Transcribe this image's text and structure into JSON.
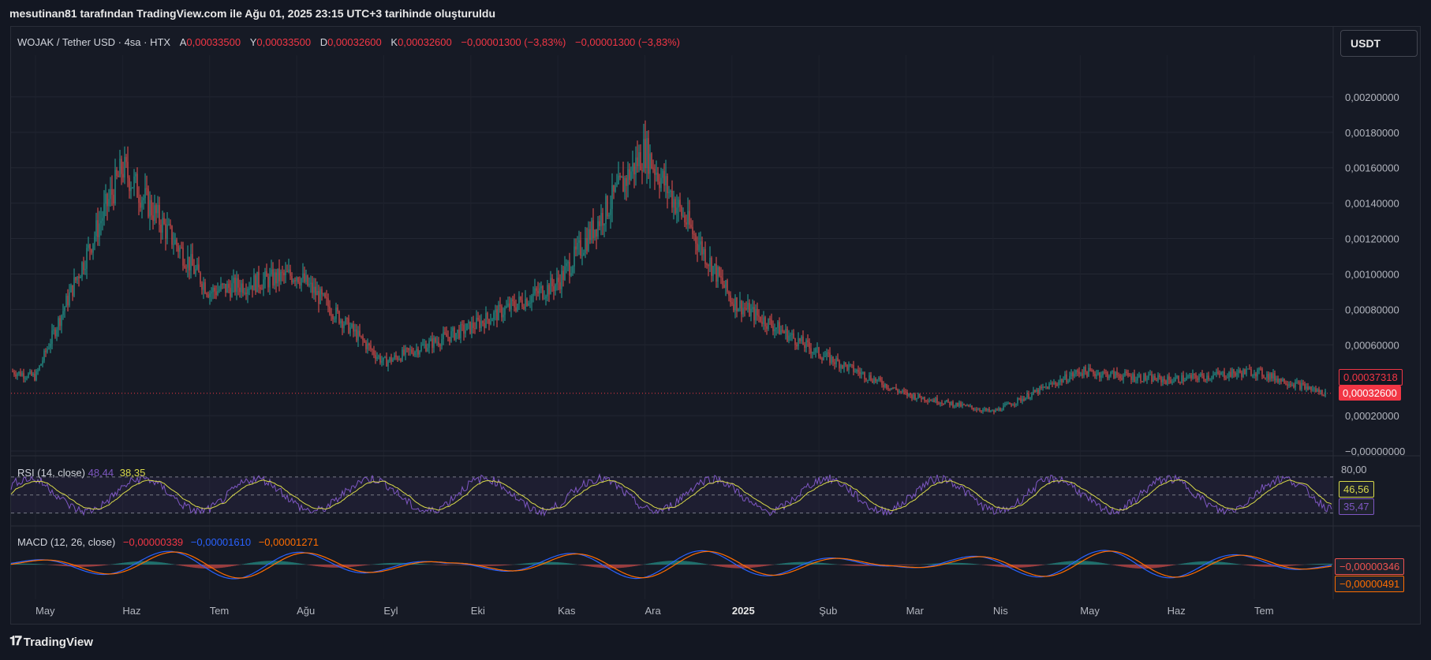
{
  "header": {
    "text": "mesutinan81 tarafından TradingView.com ile Ağu 01, 2025 23:15 UTC+3 tarihinde oluşturuldu"
  },
  "legend": {
    "symbol": "WOJAK / Tether USD · 4sa · HTX",
    "open_label": "A",
    "open": "0,00033500",
    "high_label": "Y",
    "high": "0,00033500",
    "low_label": "D",
    "low": "0,00032600",
    "close_label": "K",
    "close": "0,00032600",
    "change": "−0,00001300 (−3,83%)",
    "change2": "−0,00001300 (−3,83%)"
  },
  "currency_button": "USDT",
  "rsi": {
    "label": "RSI (14, close)",
    "value1": "48,44",
    "value2": "38,35",
    "axis_top": "80,00",
    "tag_yellow": "46,56",
    "tag_purple": "35,47"
  },
  "macd": {
    "label": "MACD (12, 26, close)",
    "hist": "−0,00000339",
    "macd": "−0,00001610",
    "signal": "−0,00001271",
    "tag_red": "−0,00000346",
    "tag_orange": "−0,00000491"
  },
  "price_tags": {
    "sma": "0,00037318",
    "last": "0,00032600"
  },
  "footer": {
    "brand": "TradingView"
  },
  "colors": {
    "up": "#26a69a",
    "down": "#ef5350",
    "rsi_line": "#7e57c2",
    "rsi_signal": "#d9d94a",
    "macd_line": "#2962ff",
    "macd_signal": "#ff6d00",
    "last_price": "#f23645"
  },
  "chart_data": [
    {
      "type": "candlestick",
      "title": "WOJAK / Tether USD · 4sa · HTX",
      "price_axis_labels": [
        "0,00200000",
        "0,00180000",
        "0,00160000",
        "0,00140000",
        "0,00120000",
        "0,00100000",
        "0,00080000",
        "0,00060000",
        "0,00020000",
        "−0,00000000"
      ],
      "time_axis_labels": [
        "May",
        "Haz",
        "Tem",
        "Ağu",
        "Eyl",
        "Eki",
        "Kas",
        "Ara",
        "2025",
        "Şub",
        "Mar",
        "Nis",
        "May",
        "Haz",
        "Tem"
      ],
      "ylim": [
        0,
        0.0022
      ],
      "approx_close_by_month": [
        {
          "x": "May",
          "value": 0.00042
        },
        {
          "x": "Haz",
          "value": 0.0016
        },
        {
          "x": "Tem",
          "value": 0.0009
        },
        {
          "x": "Ağu",
          "value": 0.001
        },
        {
          "x": "Eyl",
          "value": 0.0005
        },
        {
          "x": "Eki",
          "value": 0.0007
        },
        {
          "x": "Kas",
          "value": 0.00095
        },
        {
          "x": "Ara",
          "value": 0.0017
        },
        {
          "x": "2025",
          "value": 0.00085
        },
        {
          "x": "Şub",
          "value": 0.00055
        },
        {
          "x": "Mar",
          "value": 0.00032
        },
        {
          "x": "Nis",
          "value": 0.00022
        },
        {
          "x": "May",
          "value": 0.00045
        },
        {
          "x": "Haz",
          "value": 0.0004
        },
        {
          "x": "Tem",
          "value": 0.00045
        }
      ],
      "last_price": 0.000326,
      "sma_value": 0.00037318
    },
    {
      "type": "line",
      "title": "RSI (14, close)",
      "ylim": [
        20,
        90
      ],
      "levels": [
        70,
        30
      ],
      "last": 46.56
    },
    {
      "type": "line",
      "title": "MACD (12, 26, close)",
      "last_macd": -3.46e-06,
      "last_signal": -4.91e-06
    }
  ]
}
